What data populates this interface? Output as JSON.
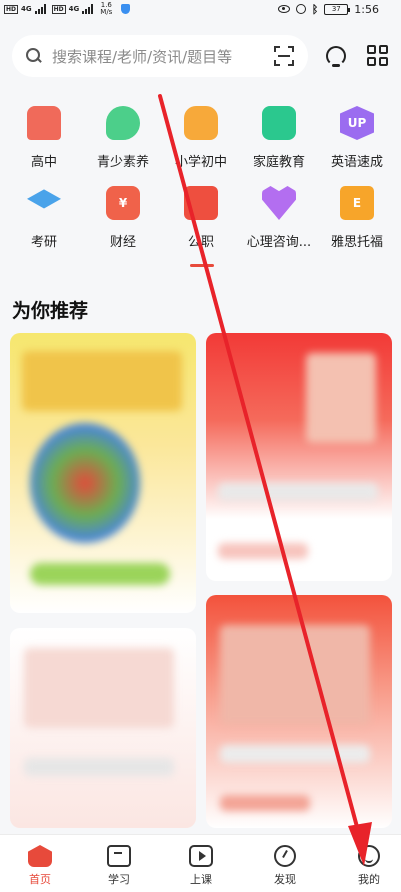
{
  "status_bar": {
    "network_tag_1": "HD",
    "network_tag_2": "HD",
    "net_1": "4G",
    "net_2": "4G",
    "speed_value": "1.6",
    "speed_unit": "M/s",
    "battery": "37",
    "time": "1:56"
  },
  "search": {
    "placeholder": "搜索课程/老师/资讯/题目等"
  },
  "categories": [
    {
      "label": "高中",
      "color": "#f06a5a"
    },
    {
      "label": "青少素养",
      "color": "#4ccf8a"
    },
    {
      "label": "小学初中",
      "color": "#f7a93a"
    },
    {
      "label": "家庭教育",
      "color": "#2bc88e"
    },
    {
      "label": "英语速成",
      "color": "#9b6cf0",
      "icon_text": "UP"
    },
    {
      "label": "考研",
      "color": "#4aa3ea"
    },
    {
      "label": "财经",
      "color": "#f0624a",
      "icon_text": "¥"
    },
    {
      "label": "公职",
      "color": "#ee4f3f"
    },
    {
      "label": "心理咨询...",
      "color": "#b36ef0"
    },
    {
      "label": "雅思托福",
      "color": "#f7a52a",
      "icon_text": "E"
    }
  ],
  "recommend": {
    "title": "为你推荐"
  },
  "tab_bar": {
    "items": [
      {
        "label": "首页",
        "active": true
      },
      {
        "label": "学习"
      },
      {
        "label": "上课"
      },
      {
        "label": "发现"
      },
      {
        "label": "我的"
      }
    ]
  },
  "colors": {
    "accent": "#e74a3b",
    "annotation_arrow": "#e8232a"
  }
}
